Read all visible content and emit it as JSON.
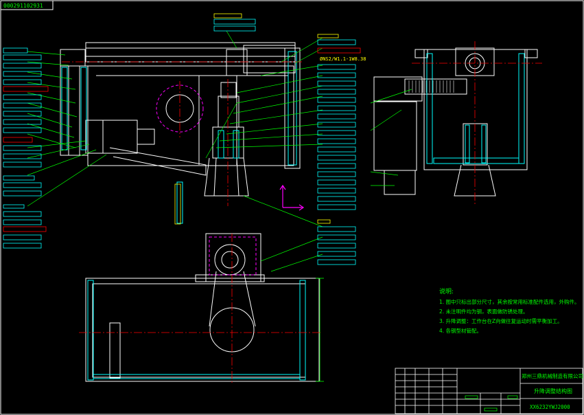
{
  "drawing": {
    "top_left_code": "000291102931",
    "center_note": "ØNS2/W1.1-1W8.38",
    "notes_title": "说明:",
    "notes": [
      "1. 图中只标出部分尺寸，其余按常用标准配件选用，外购件。",
      "2. 未注明件均为钢，表面做防锈处理。",
      "3. 升降调整：工作台在Z向做往复运动时需平衡加工。",
      "4. 各钢型材管配。"
    ],
    "company": "郑州三鼎机械制造有限公司",
    "drawing_title": "升降调整结构图",
    "drawing_number": "XX6232YWJ2000"
  },
  "colors": {
    "background": "#000000",
    "outline": "#ffffff",
    "leader": "#00ff00",
    "label_box": "#00ffff",
    "dim_text": "#ffff00",
    "hidden": "#ff00ff",
    "centerline": "#ff0000"
  }
}
